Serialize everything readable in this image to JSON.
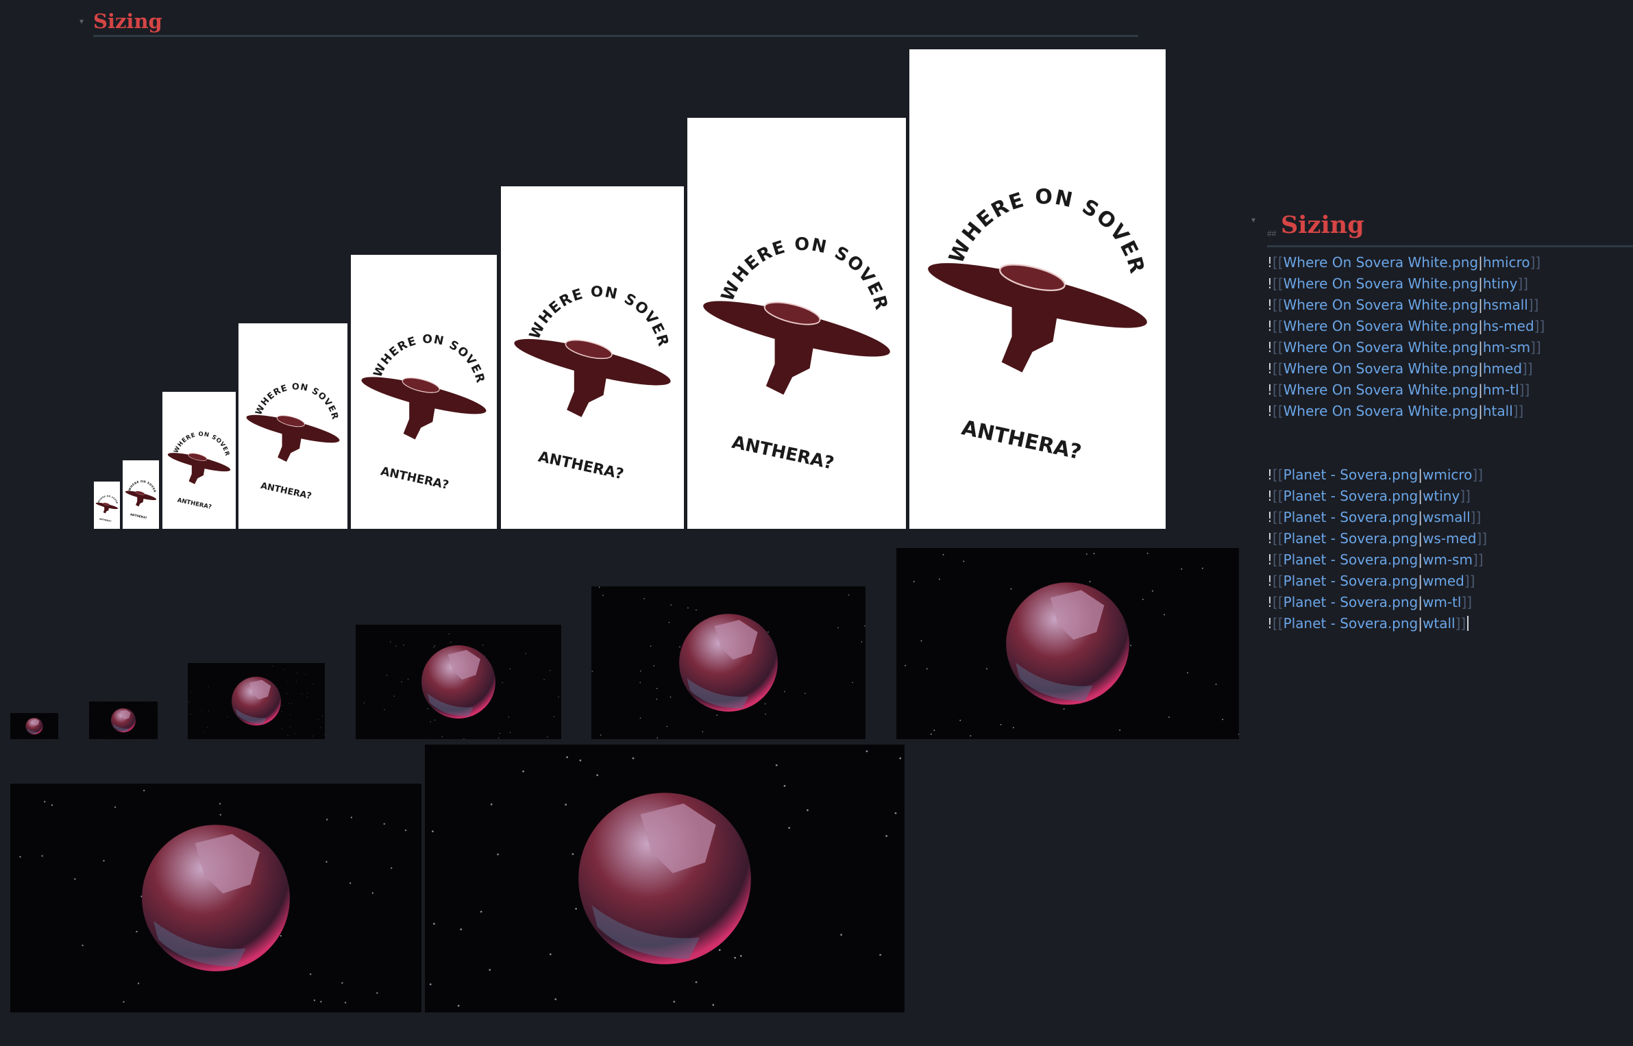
{
  "preview": {
    "heading": "Sizing",
    "poster_lines": [
      "WHERE ON SOVERA IS",
      "ANTHERA?"
    ]
  },
  "source": {
    "heading": "Sizing",
    "poster_embeds": [
      {
        "file": "Where On Sovera White.png",
        "size": "hmicro"
      },
      {
        "file": "Where On Sovera White.png",
        "size": "htiny"
      },
      {
        "file": "Where On Sovera White.png",
        "size": "hsmall"
      },
      {
        "file": "Where On Sovera White.png",
        "size": "hs-med"
      },
      {
        "file": "Where On Sovera White.png",
        "size": "hm-sm"
      },
      {
        "file": "Where On Sovera White.png",
        "size": "hmed"
      },
      {
        "file": "Where On Sovera White.png",
        "size": "hm-tl"
      },
      {
        "file": "Where On Sovera White.png",
        "size": "htall"
      }
    ],
    "planet_embeds": [
      {
        "file": "Planet - Sovera.png",
        "size": "wmicro"
      },
      {
        "file": "Planet - Sovera.png",
        "size": "wtiny"
      },
      {
        "file": "Planet - Sovera.png",
        "size": "wsmall"
      },
      {
        "file": "Planet - Sovera.png",
        "size": "ws-med"
      },
      {
        "file": "Planet - Sovera.png",
        "size": "wm-sm"
      },
      {
        "file": "Planet - Sovera.png",
        "size": "wmed"
      },
      {
        "file": "Planet - Sovera.png",
        "size": "wm-tl"
      },
      {
        "file": "Planet - Sovera.png",
        "size": "wtall"
      }
    ],
    "syntax": {
      "bang": "!",
      "open": "[[",
      "close": "]]",
      "pipe": "|"
    }
  },
  "colors": {
    "background": "#1b1d24",
    "heading": "#d64545",
    "link": "#6aa6e8",
    "poster_ink": "#4a1418",
    "planet_surface": "#7a2a3e"
  }
}
